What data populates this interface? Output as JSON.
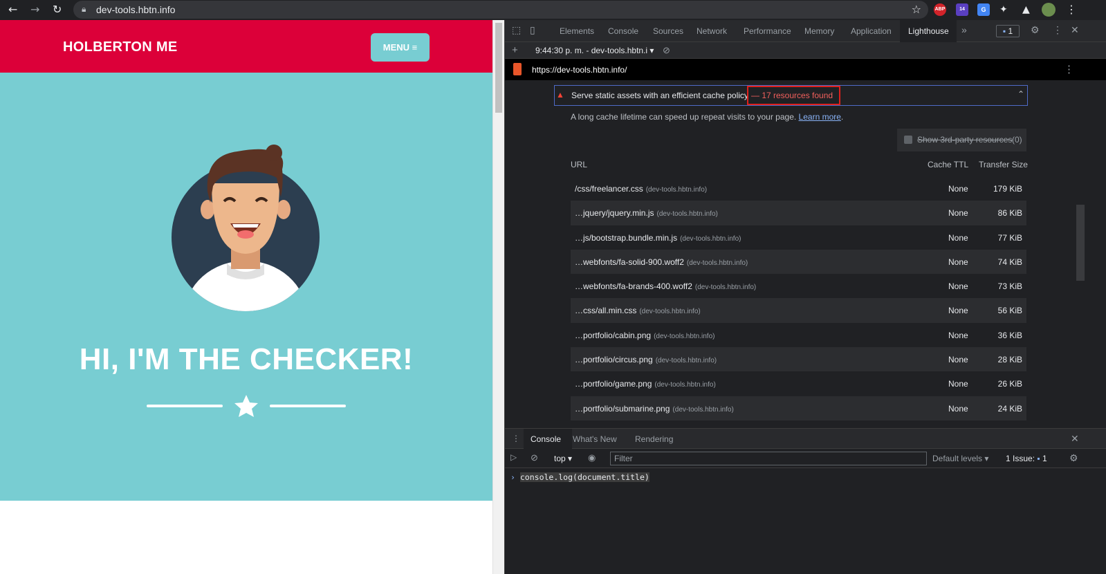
{
  "browser": {
    "url": "dev-tools.hbtn.info",
    "ext_abp": "ABP",
    "ext_badge": "14"
  },
  "site": {
    "brand": "HOLBERTON ME",
    "menu_label": "MENU ≡",
    "hero_title": "HI, I'M THE CHECKER!"
  },
  "devtools": {
    "tabs": [
      "Elements",
      "Console",
      "Sources",
      "Network",
      "Performance",
      "Memory",
      "Application",
      "Lighthouse"
    ],
    "active_tab": "Lighthouse",
    "issues_count": "1",
    "report_selector": "9:44:30 p. m. - dev-tools.hbtn.i",
    "report_url": "https://dev-tools.hbtn.info/",
    "audit": {
      "title": "Serve static assets with an efficient cache policy",
      "found": "— 17 resources found",
      "description": "A long cache lifetime can speed up repeat visits to your page.",
      "learn_more": "Learn more",
      "third_party": "Show 3rd-party resources",
      "third_party_count": "(0)",
      "col_url": "URL",
      "col_ttl": "Cache TTL",
      "col_size": "Transfer Size",
      "rows": [
        {
          "url": "/css/freelancer.css",
          "host": "(dev-tools.hbtn.info)",
          "ttl": "None",
          "size": "179 KiB"
        },
        {
          "url": "…jquery/jquery.min.js",
          "host": "(dev-tools.hbtn.info)",
          "ttl": "None",
          "size": "86 KiB"
        },
        {
          "url": "…js/bootstrap.bundle.min.js",
          "host": "(dev-tools.hbtn.info)",
          "ttl": "None",
          "size": "77 KiB"
        },
        {
          "url": "…webfonts/fa-solid-900.woff2",
          "host": "(dev-tools.hbtn.info)",
          "ttl": "None",
          "size": "74 KiB"
        },
        {
          "url": "…webfonts/fa-brands-400.woff2",
          "host": "(dev-tools.hbtn.info)",
          "ttl": "None",
          "size": "73 KiB"
        },
        {
          "url": "…css/all.min.css",
          "host": "(dev-tools.hbtn.info)",
          "ttl": "None",
          "size": "56 KiB"
        },
        {
          "url": "…portfolio/cabin.png",
          "host": "(dev-tools.hbtn.info)",
          "ttl": "None",
          "size": "36 KiB"
        },
        {
          "url": "…portfolio/circus.png",
          "host": "(dev-tools.hbtn.info)",
          "ttl": "None",
          "size": "28 KiB"
        },
        {
          "url": "…portfolio/game.png",
          "host": "(dev-tools.hbtn.info)",
          "ttl": "None",
          "size": "26 KiB"
        },
        {
          "url": "…portfolio/submarine.png",
          "host": "(dev-tools.hbtn.info)",
          "ttl": "None",
          "size": "24 KiB"
        }
      ]
    },
    "drawer": {
      "tabs": [
        "Console",
        "What's New",
        "Rendering"
      ],
      "context": "top",
      "filter_placeholder": "Filter",
      "levels": "Default levels",
      "issues_label": "1 Issue:",
      "issues_count": "1",
      "console_input": "console.log(document.title)"
    }
  },
  "colors": {
    "header_red": "#dc0039",
    "hero_teal": "#78cdd2",
    "highlight_red": "#e0201d"
  }
}
